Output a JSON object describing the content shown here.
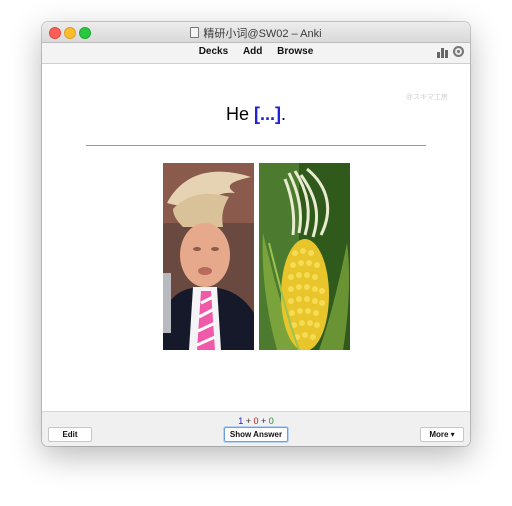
{
  "window": {
    "title": "精研小词@SW02 – Anki"
  },
  "toolbar": {
    "decks_label": "Decks",
    "add_label": "Add",
    "browse_label": "Browse"
  },
  "card": {
    "question_prefix": "He ",
    "cloze_text": "[...]",
    "question_suffix": ".",
    "watermark": "@スキマ工房",
    "images": [
      "portrait-photo",
      "corn-photo"
    ]
  },
  "bottom": {
    "count_new": "1",
    "count_learn": "0",
    "count_review": "0",
    "plus": " + ",
    "edit_label": "Edit",
    "show_answer_label": "Show Answer",
    "more_label": "More ▾"
  },
  "colors": {
    "cloze": "#1f22d6",
    "count_new": "#1a1ac9",
    "count_learn": "#c41a1a",
    "count_review": "#2a8a2a"
  }
}
